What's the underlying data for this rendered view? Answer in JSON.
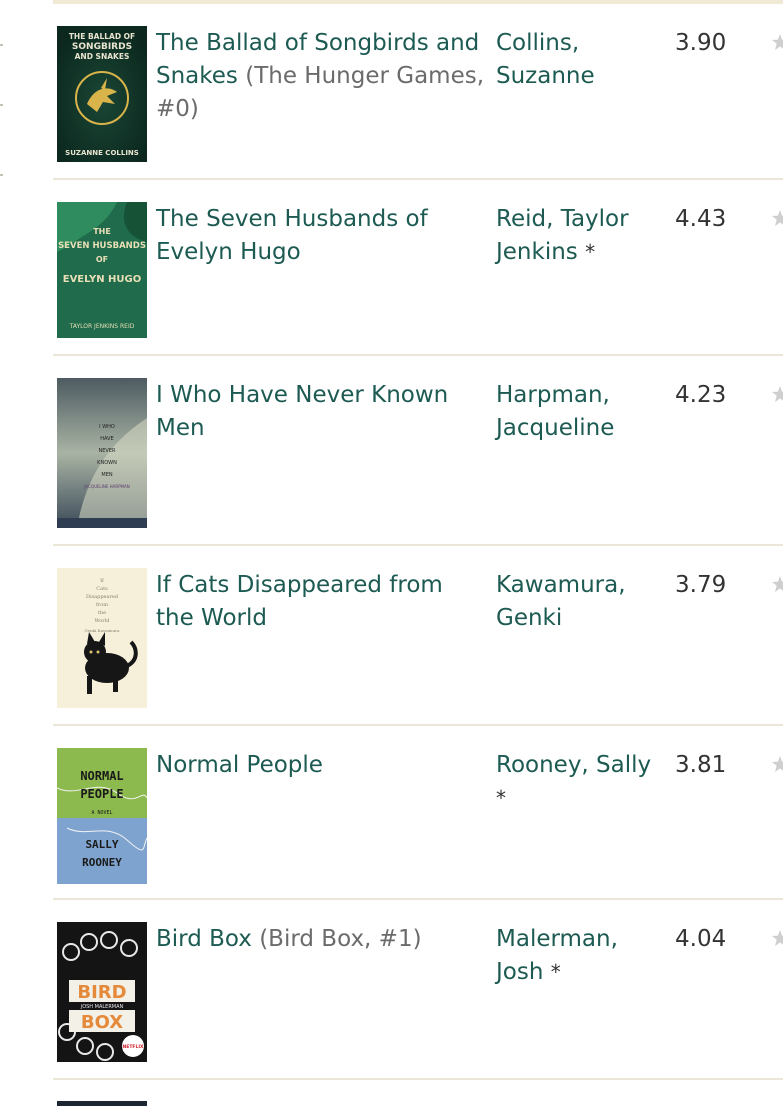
{
  "books": [
    {
      "title": "The Ballad of Songbirds and Snakes",
      "series": "(The Hunger Games, #0)",
      "author": "Collins, Suzanne",
      "author_note": "",
      "rating": "3.90",
      "cover": {
        "icon": "hunger-games-mockingjay-cover",
        "line1": "THE BALLAD OF",
        "line2": "SONGBIRDS",
        "line3": "AND SNAKES",
        "byline": "SUZANNE COLLINS",
        "bg": "#0f3327",
        "accent": "#d9b44a"
      }
    },
    {
      "title": "The Seven Husbands of Evelyn Hugo",
      "series": "",
      "author": "Reid, Taylor Jenkins",
      "author_note": "*",
      "rating": "4.43",
      "cover": {
        "icon": "green-dress-cover",
        "line1": "THE",
        "line2": "SEVEN HUSBANDS",
        "line3": "OF",
        "line4": "EVELYN HUGO",
        "byline": "TAYLOR JENKINS REID",
        "bg": "#1f6b4b",
        "accent": "#e9dfb6"
      }
    },
    {
      "title": "I Who Have Never Known Men",
      "series": "",
      "author": "Harpman, Jacqueline",
      "author_note": "",
      "rating": "4.23",
      "cover": {
        "icon": "misty-landscape-cover",
        "line1": "I WHO",
        "line2": "HAVE",
        "line3": "NEVER",
        "line4": "KNOWN",
        "line5": "MEN",
        "byline": "JACQUELINE HARPMAN",
        "bg": "#6f7a6a",
        "accent": "#e2d98f"
      }
    },
    {
      "title": "If Cats Disappeared from the World",
      "series": "",
      "author": "Kawamura, Genki",
      "author_note": "",
      "rating": "3.79",
      "cover": {
        "icon": "black-cat-cover",
        "line1": "If",
        "line2": "Cats",
        "line3": "Disappeared",
        "line4": "from",
        "line5": "the",
        "line6": "World",
        "byline": "Genki Kawamura",
        "bg": "#f6efd9",
        "accent": "#161616"
      }
    },
    {
      "title": "Normal People",
      "series": "",
      "author": "Rooney, Sally",
      "author_note": "*",
      "rating": "3.81",
      "cover": {
        "icon": "normal-people-cover",
        "line1": "NORMAL",
        "line2": "PEOPLE",
        "line3": "A NOVEL",
        "line4": "SALLY",
        "line5": "ROONEY",
        "bg": "#8dba4e",
        "accent": "#7ea3cf"
      }
    },
    {
      "title": "Bird Box",
      "series": "(Bird Box, #1)",
      "author": "Malerman, Josh",
      "author_note": "*",
      "rating": "4.04",
      "cover": {
        "icon": "rotary-dial-cover",
        "line1": "BIRD",
        "line2": "JOSH MALERMAN",
        "line3": "BOX",
        "badge": "NETFLIX",
        "bg": "#141414",
        "accent": "#e58a3a"
      }
    }
  ],
  "colors": {
    "link": "#1c5a52",
    "series": "#6b6b6b",
    "rating": "#333333",
    "divider": "#ebe6d7",
    "star_empty": "#cfcfcf"
  }
}
